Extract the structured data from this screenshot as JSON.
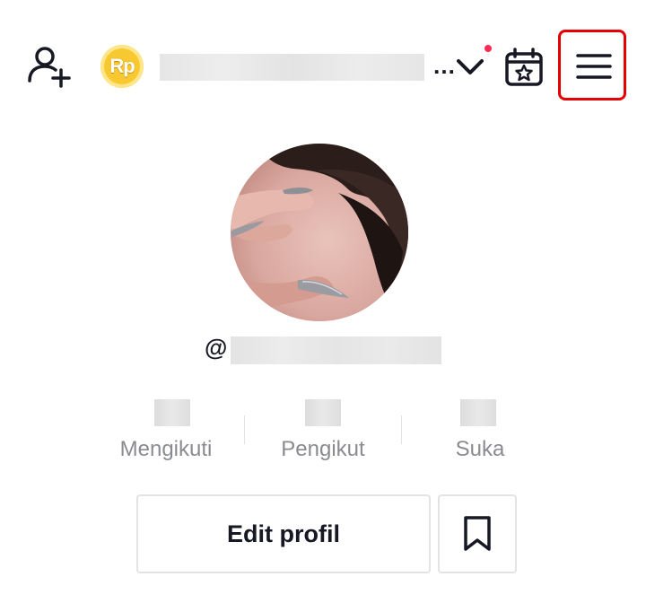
{
  "header": {
    "add_user_icon": "person-plus-icon",
    "coin_label": "Rp",
    "ellipsis": "…",
    "chevron_icon": "chevron-down-icon",
    "notification_dot_color": "#fe2c55",
    "calendar_icon": "calendar-star-icon",
    "menu_icon": "hamburger-menu-icon",
    "highlight_color": "#e60000"
  },
  "profile": {
    "at_symbol": "@"
  },
  "stats": [
    {
      "label": "Mengikuti"
    },
    {
      "label": "Pengikut"
    },
    {
      "label": "Suka"
    }
  ],
  "actions": {
    "edit_profile_label": "Edit profil",
    "bookmark_icon": "bookmark-icon"
  }
}
